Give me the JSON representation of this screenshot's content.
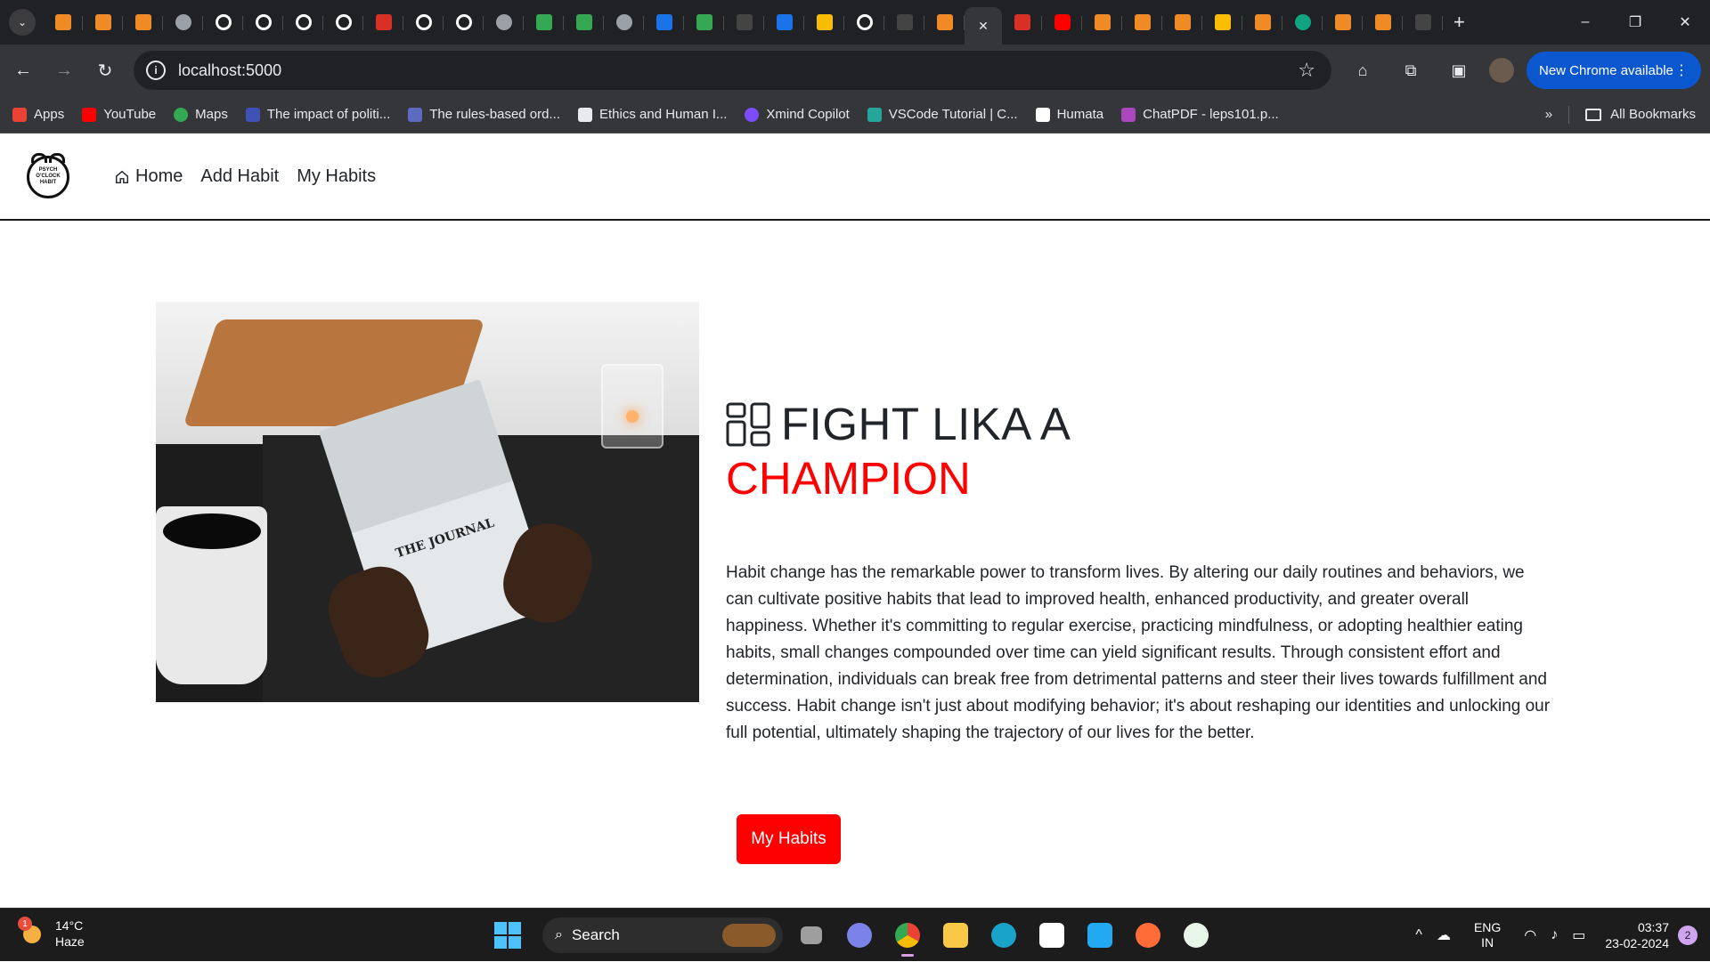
{
  "browser": {
    "tabs_count": 37,
    "new_tab_label": "+",
    "url": "localhost:5000",
    "update_label": "New Chrome available",
    "window_controls": {
      "minimize": "–",
      "restore": "❐",
      "close": "✕"
    }
  },
  "bookmarks": {
    "items": [
      {
        "label": "Apps",
        "icon": "apps-grid-icon",
        "color": "#ea4335"
      },
      {
        "label": "YouTube",
        "icon": "youtube-icon",
        "color": "#ff0000"
      },
      {
        "label": "Maps",
        "icon": "maps-pin-icon",
        "color": "#34a853"
      },
      {
        "label": "The impact of politi...",
        "icon": "page-icon",
        "color": "#3f51b5"
      },
      {
        "label": "The rules-based ord...",
        "icon": "page-icon",
        "color": "#5c6bc0"
      },
      {
        "label": "Ethics and Human I...",
        "icon": "page-icon",
        "color": "#e8eaed"
      },
      {
        "label": "Xmind Copilot",
        "icon": "xmind-icon",
        "color": "#7c4dff"
      },
      {
        "label": "VSCode Tutorial | C...",
        "icon": "page-icon",
        "color": "#26a69a"
      },
      {
        "label": "Humata",
        "icon": "humata-icon",
        "color": "#ffffff"
      },
      {
        "label": "ChatPDF - leps101.p...",
        "icon": "chatpdf-icon",
        "color": "#ab47bc"
      }
    ],
    "overflow": "»",
    "all_bookmarks": "All Bookmarks"
  },
  "site": {
    "logo_text": "PSYCH O'CLOCK HABIT",
    "nav": [
      {
        "label": "Home"
      },
      {
        "label": "Add Habit"
      },
      {
        "label": "My Habits"
      }
    ],
    "hero": {
      "book_title": "THE JOURNAL",
      "title": "FIGHT LIKA A",
      "subtitle": "CHAMPION",
      "body": "Habit change has the remarkable power to transform lives. By altering our daily routines and behaviors, we can cultivate positive habits that lead to improved health, enhanced productivity, and greater overall happiness. Whether it's committing to regular exercise, practicing mindfulness, or adopting healthier eating habits, small changes compounded over time can yield significant results. Through consistent effort and determination, individuals can break free from detrimental patterns and steer their lives towards fulfillment and success. Habit change isn't just about modifying behavior; it's about reshaping our identities and unlocking our full potential, ultimately shaping the trajectory of our lives for the better.",
      "cta_label": "My Habits"
    },
    "colors": {
      "accent": "#ff0000",
      "text": "#212529"
    }
  },
  "taskbar": {
    "weather_temp": "14°C",
    "weather_desc": "Haze",
    "weather_badge": "1",
    "search_label": "Search",
    "lang_line1": "ENG",
    "lang_line2": "IN",
    "time": "03:37",
    "date": "23-02-2024",
    "notifications": "2"
  }
}
